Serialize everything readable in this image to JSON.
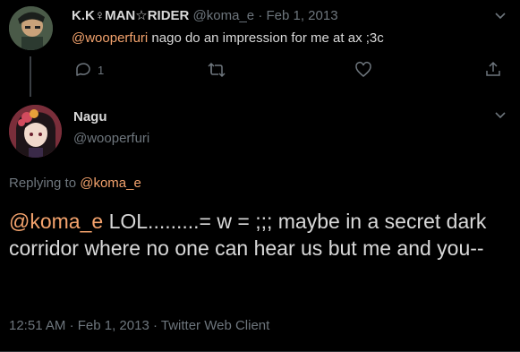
{
  "top_tweet": {
    "display_name": "K.K♀MAN☆RIDER",
    "handle": "@koma_e",
    "separator": "·",
    "date": "Feb 1, 2013",
    "mention": "@wooperfuri",
    "body": " nago do an impression for me at ax ;3c",
    "reply_count": "1"
  },
  "main_tweet": {
    "display_name": "Nagu",
    "handle": "@wooperfuri",
    "replying_to_label": "Replying to ",
    "replying_to_handle": "@koma_e",
    "mention": "@koma_e",
    "body": " LOL.........= w = ;;; maybe in a secret dark corridor where no one can hear us but me and you--",
    "time": "12:51 AM",
    "separator": "·",
    "date": "Feb 1, 2013",
    "separator2": "·",
    "client": "Twitter Web Client"
  },
  "colors": {
    "background": "#000000",
    "accent": "#f4a36d",
    "muted": "#6e767d",
    "text": "#d9d9d9"
  },
  "icons": [
    "chevron-down-icon",
    "reply-icon",
    "retweet-icon",
    "like-icon",
    "share-icon"
  ]
}
